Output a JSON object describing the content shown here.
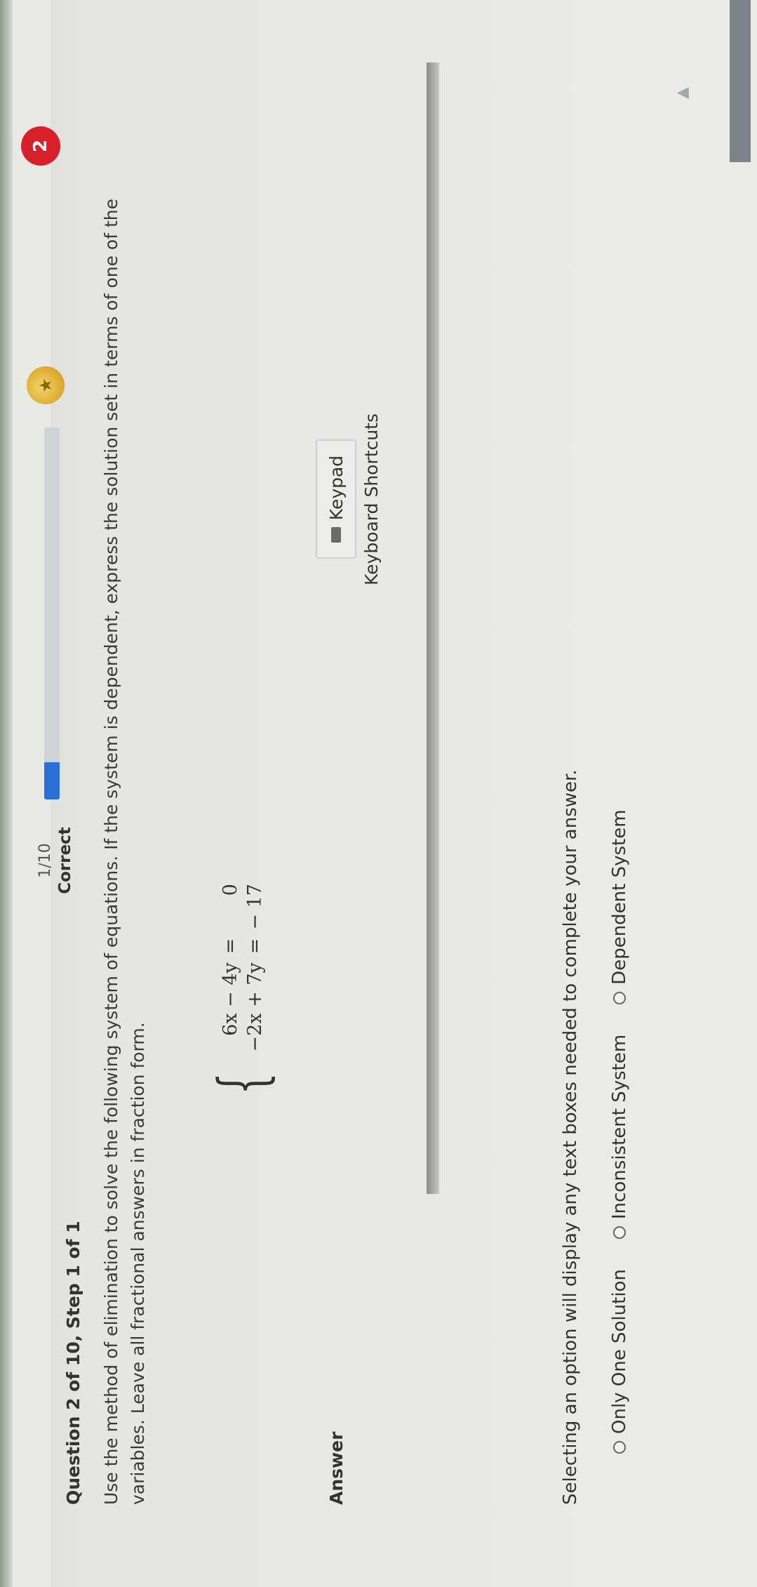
{
  "header": {
    "question_label": "Question 2 of 10, Step 1 of 1",
    "progress_text": "1/10",
    "progress_status": "Correct",
    "progress_fraction": 0.1,
    "streak_count": "2"
  },
  "question": {
    "instructions": "Use the method of elimination to solve the following system of equations. If the system is dependent, express the solution set in terms of one of the variables. Leave all fractional answers in fraction form.",
    "equations": [
      {
        "lhs": "6x − 4y",
        "sign": "=",
        "rhs": "0"
      },
      {
        "lhs": "−2x + 7y",
        "sign": "=",
        "rhs": "− 17"
      }
    ]
  },
  "answer": {
    "label": "Answer",
    "keypad_label": "Keypad",
    "keyboard_shortcuts_label": "Keyboard Shortcuts",
    "hint": "Selecting an option will display any text boxes needed to complete your answer.",
    "options": [
      "Only One Solution",
      "Inconsistent System",
      "Dependent System"
    ]
  },
  "colors": {
    "progress_fill": "#2a6fd8",
    "streak_badge": "#d8202a"
  }
}
